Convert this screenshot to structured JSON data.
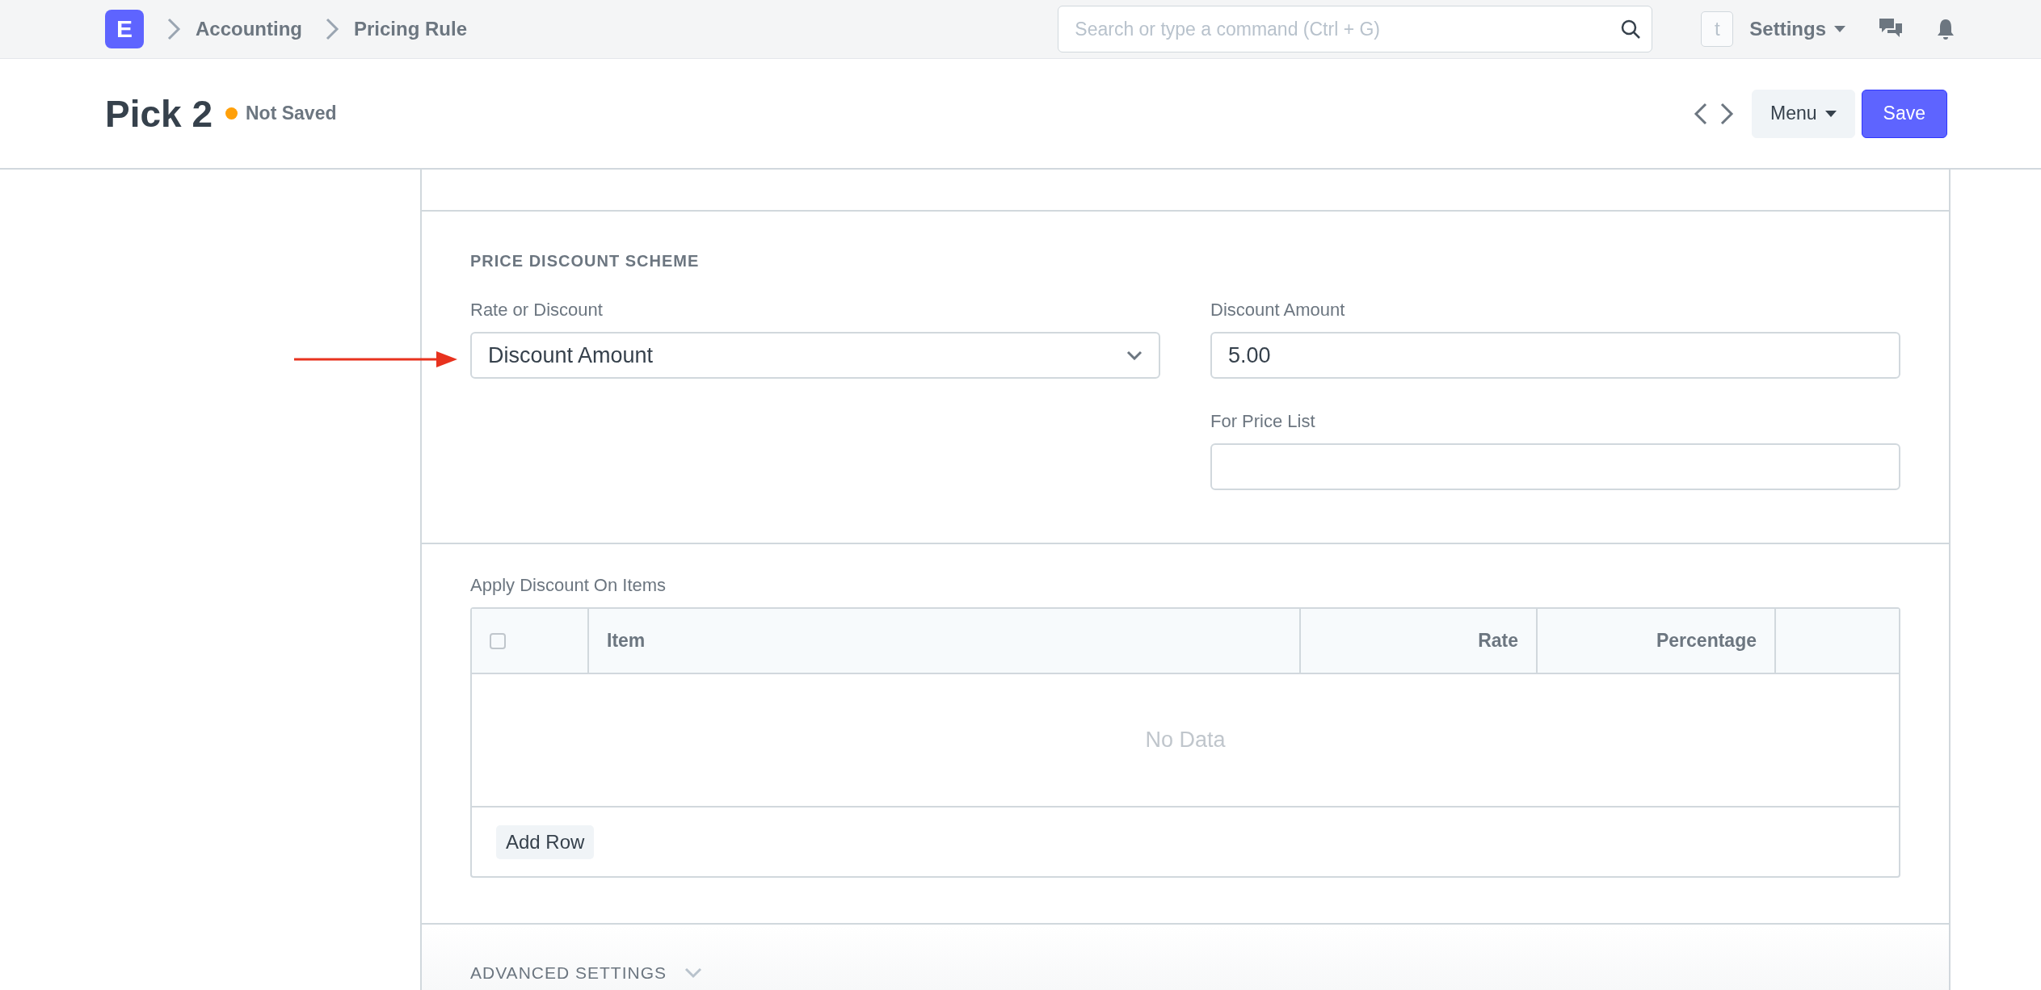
{
  "navbar": {
    "logo": "E",
    "breadcrumbs": [
      "Accounting",
      "Pricing Rule"
    ],
    "search": {
      "placeholder": "Search or type a command (Ctrl + G)"
    },
    "avatar": "t",
    "settings": "Settings"
  },
  "header": {
    "title": "Pick 2",
    "indicator": {
      "label": "Not Saved",
      "color": "#ffa00a"
    },
    "menu_button": "Menu",
    "save_button": "Save"
  },
  "price_discount_section": {
    "heading": "PRICE DISCOUNT SCHEME",
    "left_fields": [
      {
        "kind": "select",
        "label": "Rate or Discount",
        "value": "Discount Amount"
      }
    ],
    "right_fields": [
      {
        "kind": "data",
        "label": "Discount Amount",
        "value": "5.00"
      },
      {
        "kind": "data",
        "label": "For Price List"
      }
    ]
  },
  "items_table": {
    "label": "Apply Discount On Items",
    "select_all_checked": false,
    "columns": [
      {
        "label": "Item"
      },
      {
        "label": "Rate"
      },
      {
        "label": "Percentage"
      }
    ],
    "empty_text": "No Data",
    "add_row_button": "Add Row"
  },
  "advanced_section": {
    "heading": "ADVANCED SETTINGS",
    "expanded": false
  }
}
